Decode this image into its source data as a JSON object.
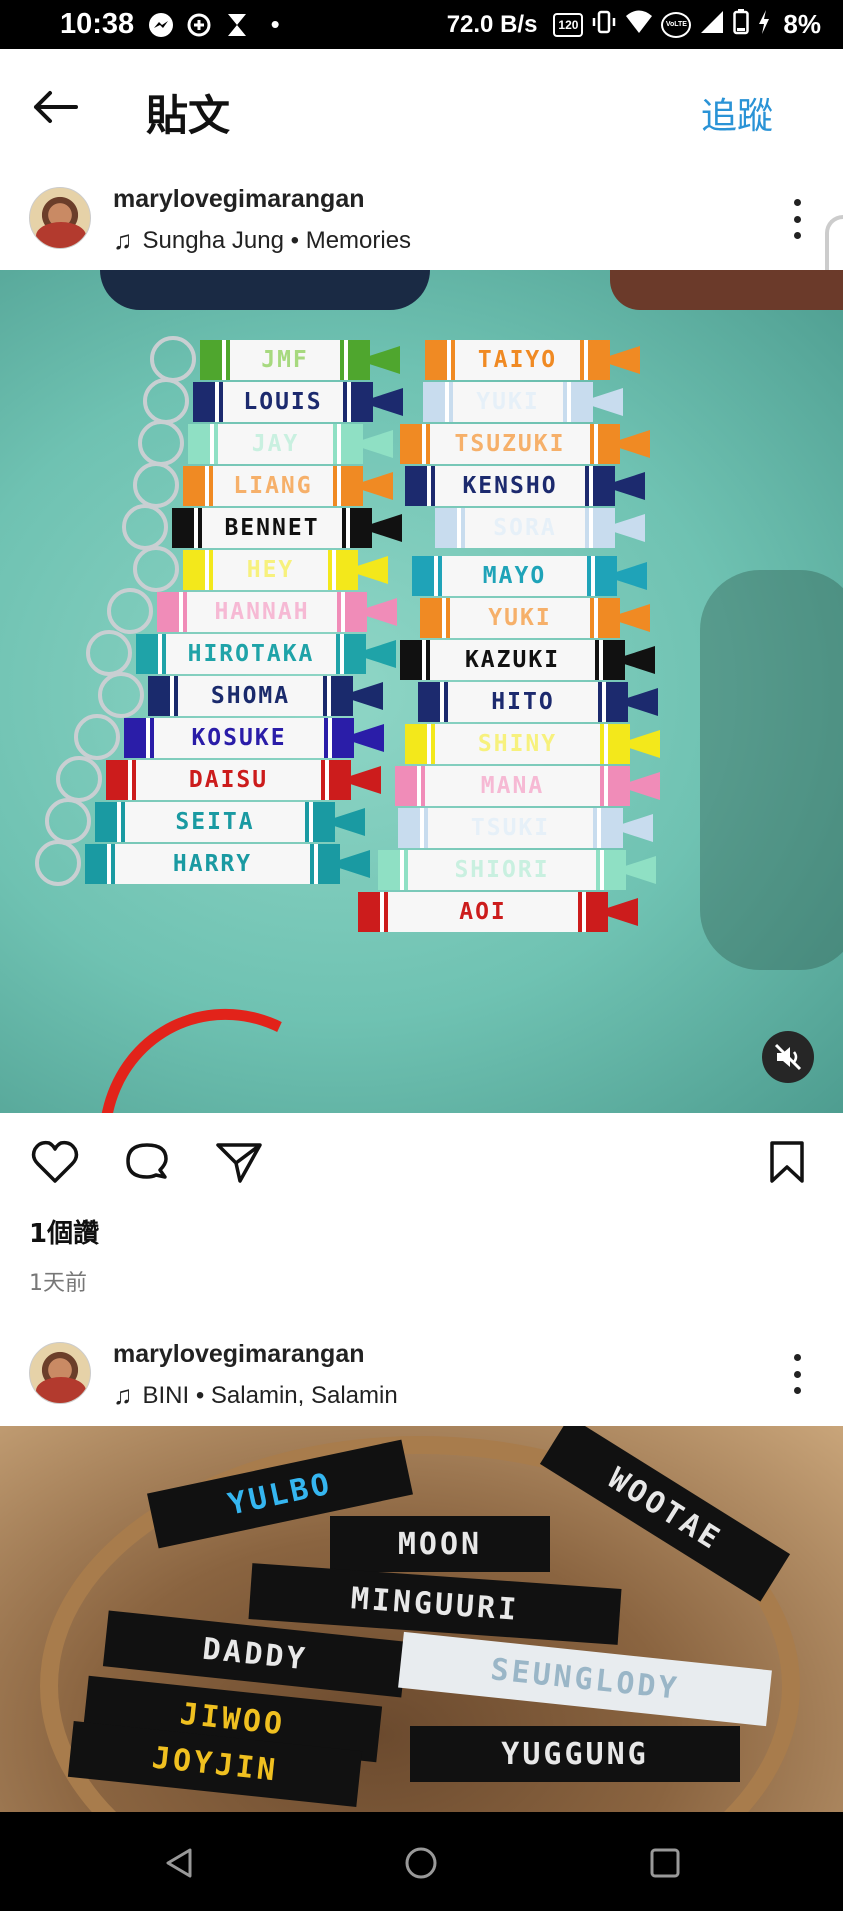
{
  "status_bar": {
    "time": "10:38",
    "dot": "•",
    "speed": "72.0 B/s",
    "battery": "8%",
    "hd_badge": "120",
    "volte_badge": "VoLTE",
    "icons": [
      "messenger-icon",
      "add-circle-icon",
      "hourglass-icon",
      "hd-badge-icon",
      "vibrate-icon",
      "wifi-icon",
      "volte-icon",
      "signal-icon",
      "battery-icon",
      "charging-icon"
    ]
  },
  "header": {
    "title": "貼文",
    "follow_label": "追蹤"
  },
  "posts": [
    {
      "username": "marylovegimarangan",
      "music": "Sungha Jung • Memories",
      "likes": "1個讚",
      "time_ago": "1天前"
    },
    {
      "username": "marylovegimarangan",
      "music": "BINI • Salamin, Salamin"
    }
  ],
  "image1": {
    "left_tags": [
      {
        "label": "JMF",
        "bg": "#4fa62e",
        "fg": "#a7d97f"
      },
      {
        "label": "LOUIS",
        "bg": "#1c2a6e",
        "fg": "#1c2a6e"
      },
      {
        "label": "JAY",
        "bg": "#8fe0c4",
        "fg": "#c9f0e0"
      },
      {
        "label": "LIANG",
        "bg": "#f08a23",
        "fg": "#f6b06a"
      },
      {
        "label": "BENNET",
        "bg": "#111111",
        "fg": "#111111"
      },
      {
        "label": "HEY",
        "bg": "#f3e81b",
        "fg": "#f7f17d"
      },
      {
        "label": "HANNAH",
        "bg": "#f08cb8",
        "fg": "#f6b9d4"
      },
      {
        "label": "HIROTAKA",
        "bg": "#1fa3a8",
        "fg": "#1fa3a8"
      },
      {
        "label": "SHOMA",
        "bg": "#1a2a6c",
        "fg": "#1a2a6c"
      },
      {
        "label": "KOSUKE",
        "bg": "#2a1da8",
        "fg": "#2a1da8"
      },
      {
        "label": "DAISU",
        "bg": "#cc1c1c",
        "fg": "#cc1c1c"
      },
      {
        "label": "SEITA",
        "bg": "#1a9aa2",
        "fg": "#1a9aa2"
      },
      {
        "label": "HARRY",
        "bg": "#1a9aa2",
        "fg": "#1a9aa2"
      }
    ],
    "right_tags": [
      {
        "label": "TAIYO",
        "bg": "#f08a23",
        "fg": "#f08a23"
      },
      {
        "label": "YUKI",
        "bg": "#c8dcee",
        "fg": "#e6f0f8"
      },
      {
        "label": "TSUZUKI",
        "bg": "#f08a23",
        "fg": "#f6b06a"
      },
      {
        "label": "KENSHO",
        "bg": "#1c2a6e",
        "fg": "#1c2a6e"
      },
      {
        "label": "SORA",
        "bg": "#c8dcee",
        "fg": "#e6f0f8"
      },
      {
        "label": "MAYO",
        "bg": "#1fa3b8",
        "fg": "#1fa3b8"
      },
      {
        "label": "YUKI",
        "bg": "#f08a23",
        "fg": "#f6b06a"
      },
      {
        "label": "KAZUKI",
        "bg": "#111111",
        "fg": "#111111"
      },
      {
        "label": "HITO",
        "bg": "#1c2a6e",
        "fg": "#1c2a6e"
      },
      {
        "label": "SHINY",
        "bg": "#f3e81b",
        "fg": "#f7f17d"
      },
      {
        "label": "MANA",
        "bg": "#f08cb8",
        "fg": "#f6b9d4"
      },
      {
        "label": "TSUKI",
        "bg": "#c8dcee",
        "fg": "#e6f0f8"
      },
      {
        "label": "SHIORI",
        "bg": "#8fe0c4",
        "fg": "#c9f0e0"
      },
      {
        "label": "AOI",
        "bg": "#cc1c1c",
        "fg": "#cc1c1c"
      }
    ]
  },
  "image2": {
    "tags": [
      {
        "label": "YULBO",
        "fg": "#35b6f0"
      },
      {
        "label": "MOON",
        "fg": "#e8e8e8"
      },
      {
        "label": "WOOTAE",
        "fg": "#e8e8e8"
      },
      {
        "label": "MINGUURI",
        "fg": "#e8e8e8"
      },
      {
        "label": "DADDY",
        "fg": "#e8e8e8"
      },
      {
        "label": "SEUNGLODY",
        "fg": "#d6ecf7"
      },
      {
        "label": "JIWOO",
        "fg": "#f0c020"
      },
      {
        "label": "JOYJIN",
        "fg": "#f0c020"
      },
      {
        "label": "YUGGUNG",
        "fg": "#e8e8e8"
      }
    ]
  },
  "nav": {
    "buttons": [
      "back-nav",
      "home-nav",
      "recents-nav"
    ]
  }
}
